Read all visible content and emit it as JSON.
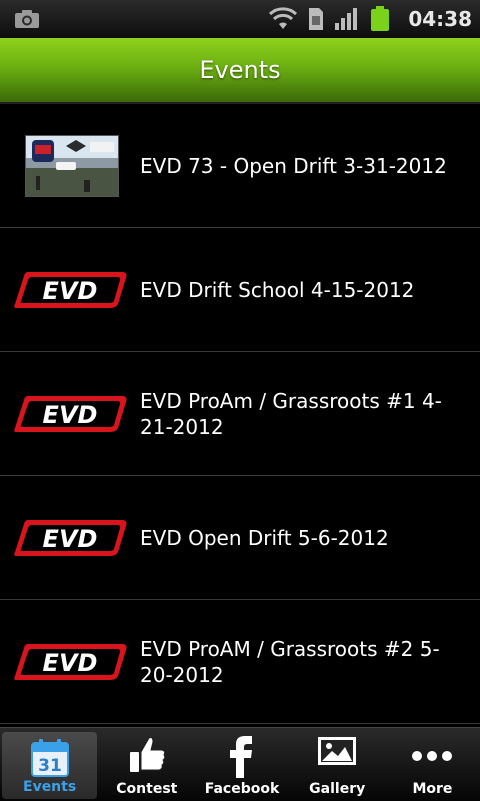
{
  "status_bar": {
    "time": "04:38",
    "icons": [
      "camera-icon",
      "wifi-icon",
      "sim-icon",
      "signal-icon",
      "battery-icon"
    ]
  },
  "header": {
    "title": "Events"
  },
  "events": [
    {
      "title": "EVD 73 - Open Drift 3-31-2012",
      "thumb": "photo"
    },
    {
      "title": "EVD Drift School 4-15-2012",
      "thumb": "evd-logo"
    },
    {
      "title": "EVD ProAm / Grassroots #1 4-21-2012",
      "thumb": "evd-logo"
    },
    {
      "title": "EVD Open Drift 5-6-2012",
      "thumb": "evd-logo"
    },
    {
      "title": "EVD ProAM / Grassroots #2 5-20-2012",
      "thumb": "evd-logo"
    }
  ],
  "logo_text": "EVD",
  "tabs": [
    {
      "label": "Events",
      "icon": "calendar-icon",
      "badge": "31",
      "active": true
    },
    {
      "label": "Contest",
      "icon": "thumbs-up-icon",
      "active": false
    },
    {
      "label": "Facebook",
      "icon": "facebook-icon",
      "active": false
    },
    {
      "label": "Gallery",
      "icon": "gallery-icon",
      "active": false
    },
    {
      "label": "More",
      "icon": "more-icon",
      "active": false
    }
  ],
  "colors": {
    "accent": "#7bc21a",
    "active_tab": "#3aa0e8",
    "logo_red": "#d8141c"
  }
}
